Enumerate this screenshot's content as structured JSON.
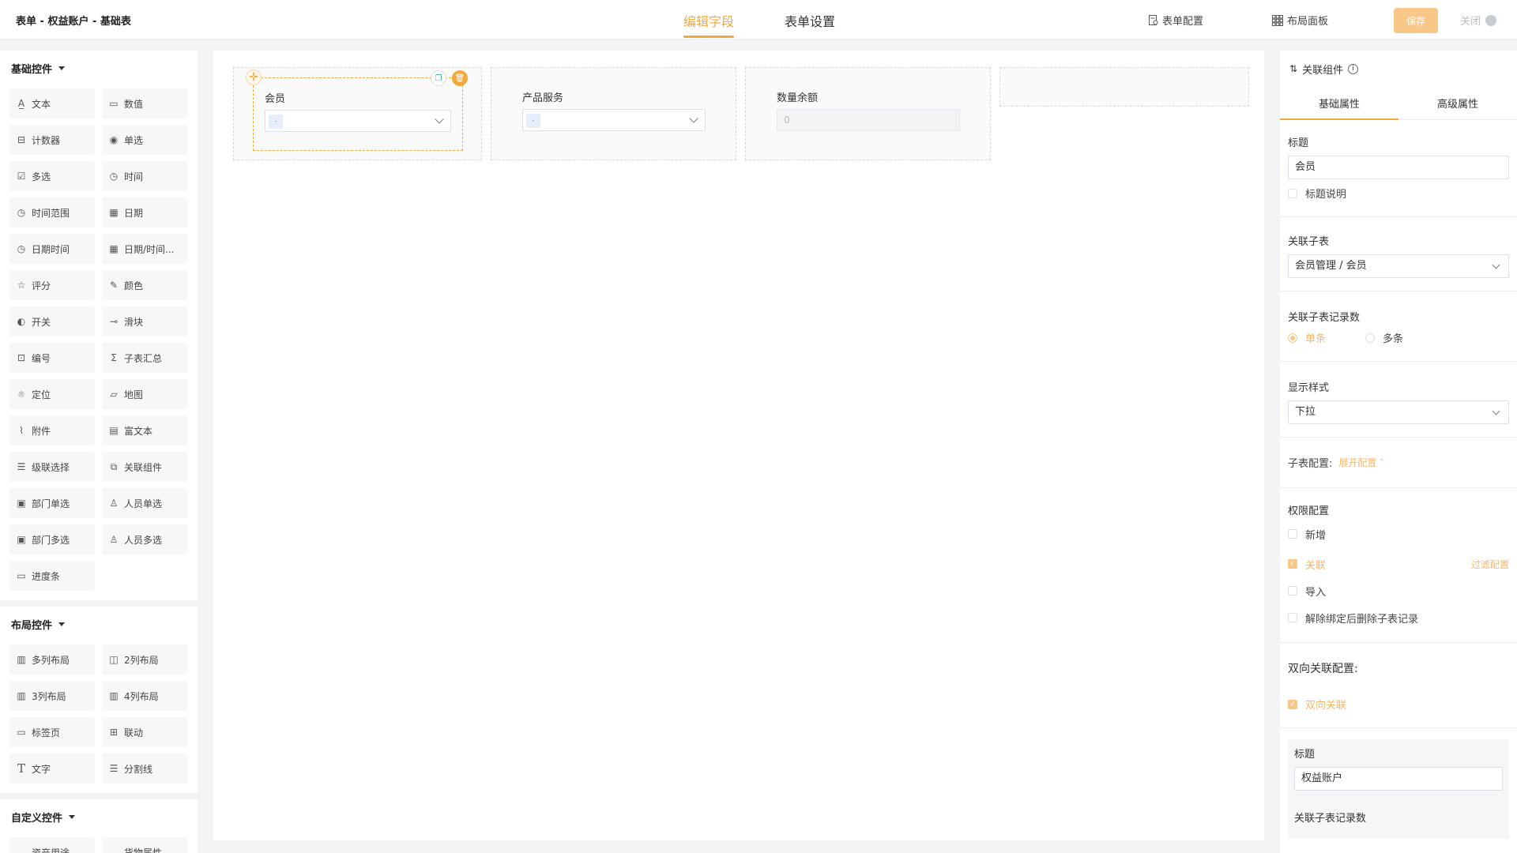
{
  "header": {
    "title": "表单 - 权益账户 - 基础表",
    "tabs": [
      {
        "label": "编辑字段",
        "active": true
      },
      {
        "label": "表单设置",
        "active": false
      }
    ],
    "form_config": "表单配置",
    "layout_panel": "布局面板",
    "save": "保存",
    "close": "关闭"
  },
  "left_panel": {
    "groups": [
      {
        "title": "基础控件",
        "items": [
          {
            "label": "文本",
            "icon": "text-icon"
          },
          {
            "label": "数值",
            "icon": "number-icon"
          },
          {
            "label": "计数器",
            "icon": "counter-icon"
          },
          {
            "label": "单选",
            "icon": "radio-icon"
          },
          {
            "label": "多选",
            "icon": "checkbox-icon"
          },
          {
            "label": "时间",
            "icon": "clock-icon"
          },
          {
            "label": "时间范围",
            "icon": "clock-icon"
          },
          {
            "label": "日期",
            "icon": "calendar-icon"
          },
          {
            "label": "日期时间",
            "icon": "clock-icon"
          },
          {
            "label": "日期/时间...",
            "icon": "calendar-icon"
          },
          {
            "label": "评分",
            "icon": "star-icon"
          },
          {
            "label": "颜色",
            "icon": "dropper-icon"
          },
          {
            "label": "开关",
            "icon": "toggle-icon"
          },
          {
            "label": "滑块",
            "icon": "slider-icon"
          },
          {
            "label": "编号",
            "icon": "serial-icon"
          },
          {
            "label": "子表汇总",
            "icon": "sigma-icon"
          },
          {
            "label": "定位",
            "icon": "location-icon"
          },
          {
            "label": "地图",
            "icon": "map-icon"
          },
          {
            "label": "附件",
            "icon": "paperclip-icon"
          },
          {
            "label": "富文本",
            "icon": "richtext-icon"
          },
          {
            "label": "级联选择",
            "icon": "cascade-icon"
          },
          {
            "label": "关联组件",
            "icon": "link-component-icon"
          },
          {
            "label": "部门单选",
            "icon": "department-icon"
          },
          {
            "label": "人员单选",
            "icon": "user-icon"
          },
          {
            "label": "部门多选",
            "icon": "department-icon"
          },
          {
            "label": "人员多选",
            "icon": "users-icon"
          },
          {
            "label": "进度条",
            "icon": "progress-icon"
          }
        ]
      },
      {
        "title": "布局控件",
        "items": [
          {
            "label": "多列布局",
            "icon": "columns-icon"
          },
          {
            "label": "2列布局",
            "icon": "columns-icon"
          },
          {
            "label": "3列布局",
            "icon": "columns-icon"
          },
          {
            "label": "4列布局",
            "icon": "columns-icon"
          },
          {
            "label": "标签页",
            "icon": "tabs-icon"
          },
          {
            "label": "联动",
            "icon": "grid-icon"
          },
          {
            "label": "文字",
            "icon": "text-t-icon"
          },
          {
            "label": "分割线",
            "icon": "divider-icon"
          }
        ]
      },
      {
        "title": "自定义控件",
        "items": [
          {
            "label": "资产用途",
            "icon": "chevron-down-icon"
          },
          {
            "label": "货物属性",
            "icon": "chevron-down-icon"
          }
        ]
      }
    ]
  },
  "canvas": {
    "fields": [
      {
        "label": "会员",
        "type": "select",
        "tag": "-"
      },
      {
        "label": "产品服务",
        "type": "select",
        "tag": "-"
      },
      {
        "label": "数量余额",
        "type": "number",
        "value": "0"
      }
    ]
  },
  "right_panel": {
    "header": "关联组件",
    "tabs": [
      {
        "label": "基础属性",
        "active": true
      },
      {
        "label": "高级属性",
        "active": false
      }
    ],
    "title_label": "标题",
    "title_value": "会员",
    "title_desc": "标题说明",
    "sub_table_label": "关联子表",
    "sub_table_value": "会员管理 / 会员",
    "record_count_label": "关联子表记录数",
    "record_single": "单条",
    "record_multi": "多条",
    "display_style_label": "显示样式",
    "display_style_value": "下拉",
    "sub_config_label": "子表配置:",
    "sub_config_link": "展开配置",
    "perm_label": "权限配置",
    "perm_items": [
      {
        "label": "新增",
        "checked": false
      },
      {
        "label": "关联",
        "checked": true
      },
      {
        "label": "导入",
        "checked": false
      },
      {
        "label": "解除绑定后删除子表记录",
        "checked": false
      }
    ],
    "filter_config": "过滤配置",
    "bidirectional_label": "双向关联配置:",
    "bidirectional_check": "双向关联",
    "sub_title_label": "标题",
    "sub_title_value": "权益账户",
    "sub_record_count_label": "关联子表记录数"
  },
  "colors": {
    "accent": "#f0a93d",
    "save_bg": "#f9c889"
  }
}
